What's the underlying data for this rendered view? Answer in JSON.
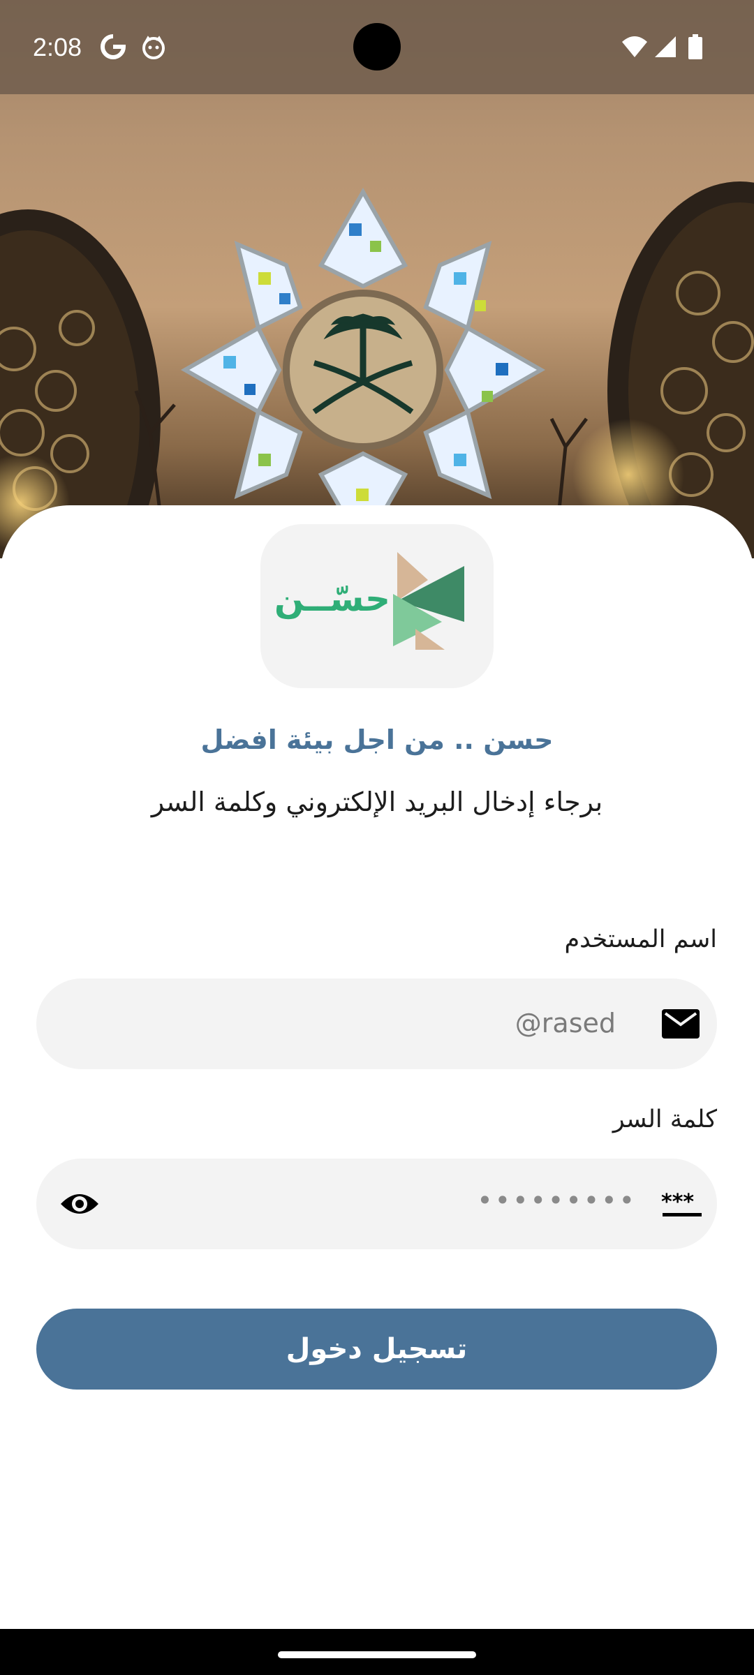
{
  "status_bar": {
    "time": "2:08",
    "icons": [
      "google-icon",
      "cat-icon",
      "wifi-icon",
      "signal-icon",
      "battery-icon"
    ]
  },
  "logo": {
    "text": "حسّــن",
    "colors": {
      "green": "#2fae77",
      "dark_green": "#3e8a66",
      "light_green": "#7fc99a",
      "tan": "#d6b697"
    }
  },
  "header": {
    "tagline": "حسن .. من اجل بيئة افضل",
    "subtitle": "برجاء إدخال البريد الإلكتروني وكلمة السر"
  },
  "form": {
    "username": {
      "label": "اسم المستخدم",
      "placeholder": "@rased",
      "icon": "mail-icon"
    },
    "password": {
      "label": "كلمة السر",
      "masked_value": "•••••••••",
      "icon": "password-icon",
      "toggle_icon": "eye-icon"
    },
    "submit_label": "تسجيل دخول"
  },
  "colors": {
    "accent": "#4a7398",
    "field_bg": "#f3f3f3",
    "sheet_bg": "#ffffff"
  }
}
